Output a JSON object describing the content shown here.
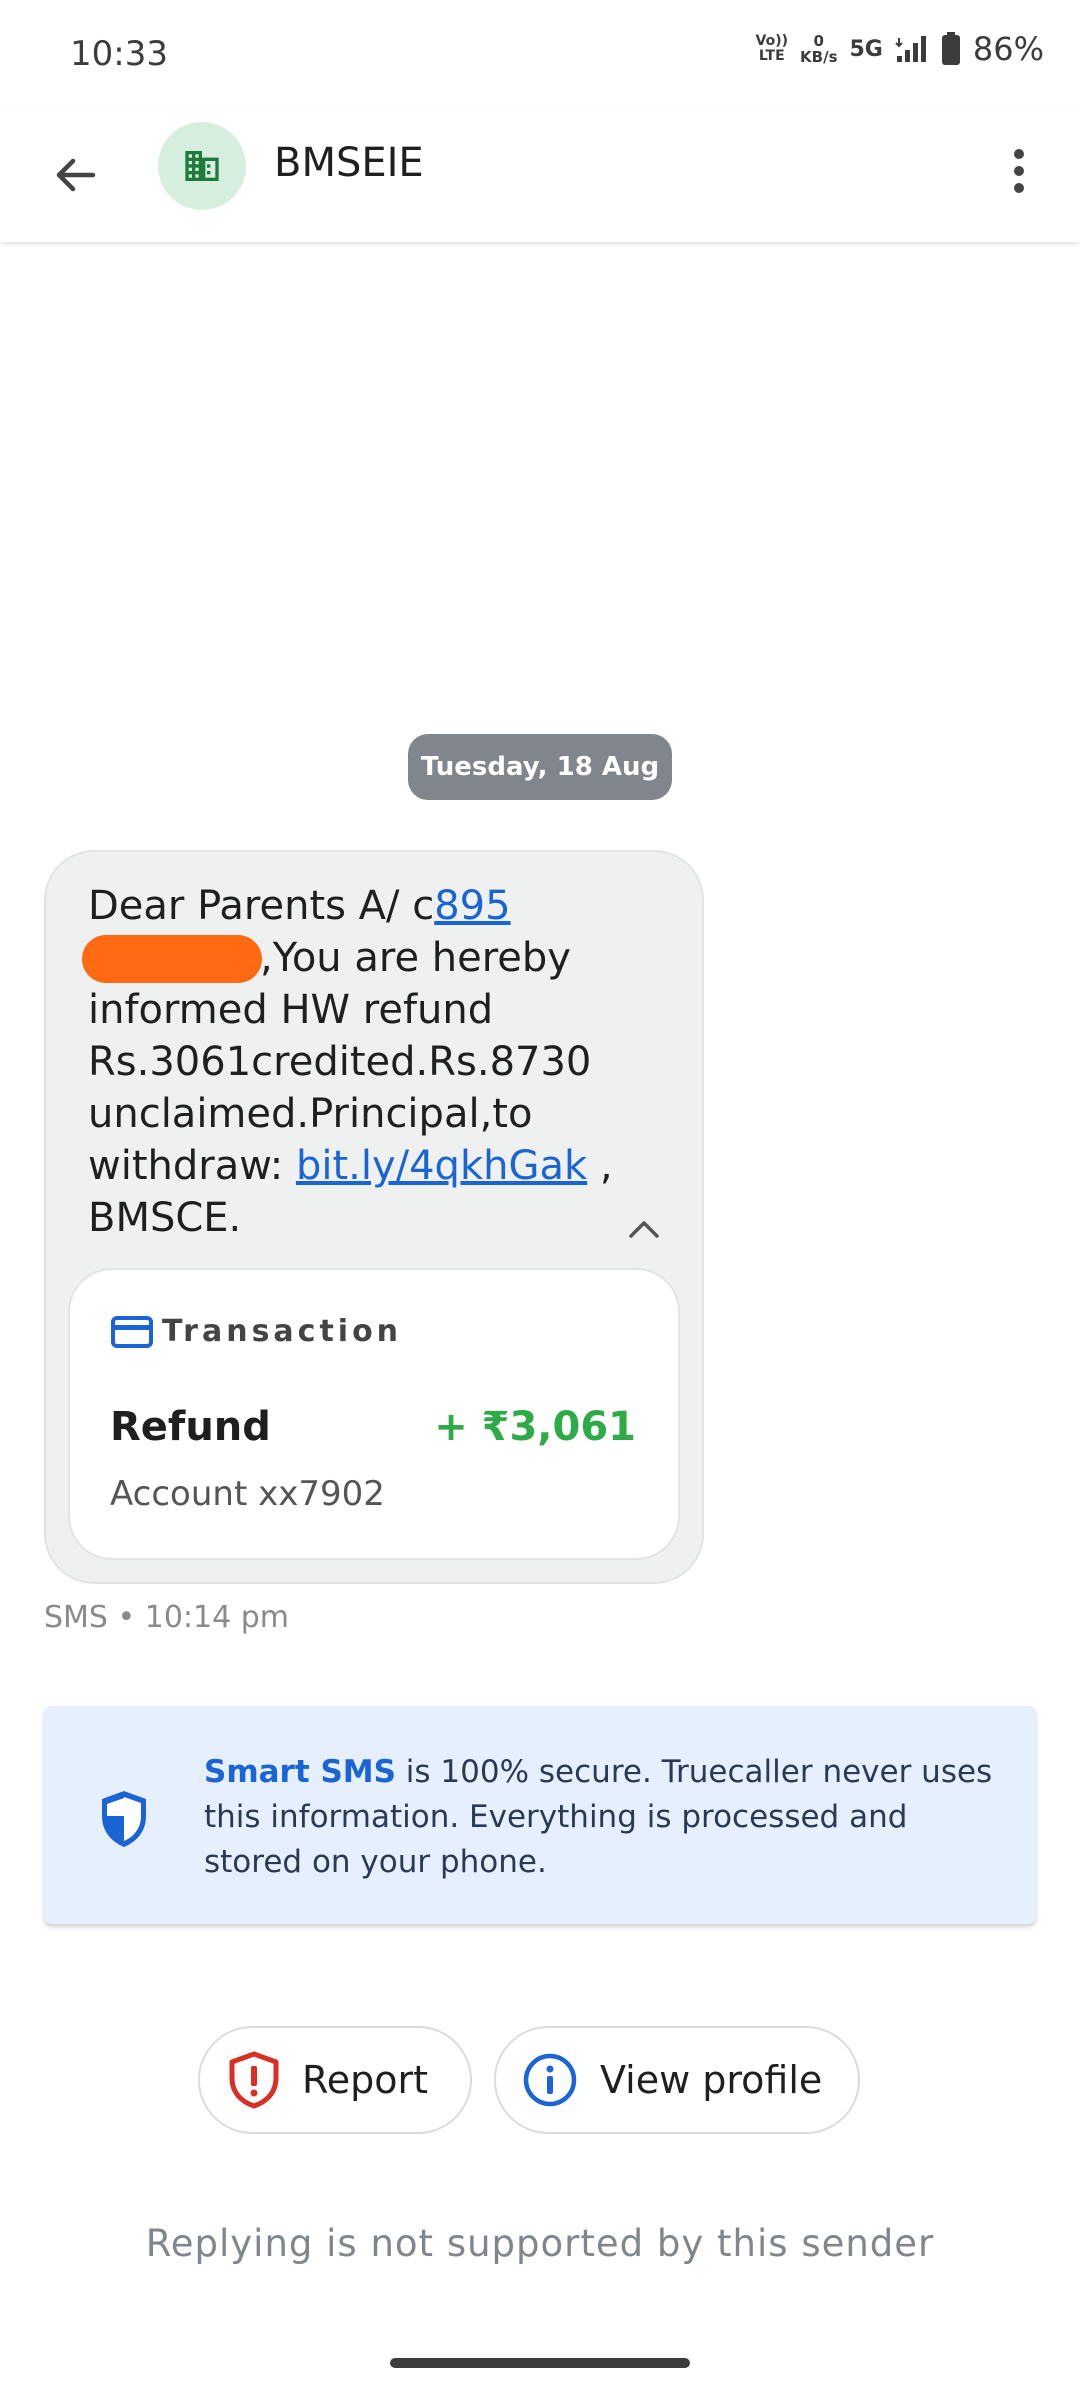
{
  "status_bar": {
    "time": "10:33",
    "volte_top": "Vo))",
    "volte_bottom": "LTE",
    "data_speed_value": "0",
    "data_speed_unit": "KB/s",
    "network": "5G",
    "battery": "86%"
  },
  "header": {
    "sender_name": "BMSEIE",
    "avatar_icon": "building-icon",
    "avatar_bg": "#d6eedd",
    "avatar_fg": "#1e7b3c"
  },
  "conversation": {
    "date_chip": "Tuesday, 18 Aug",
    "message": {
      "text_before_number": "Dear Parents A/ c",
      "account_number_visible": "895",
      "text_after_number": ",You are hereby informed HW refund Rs.3061credited.Rs.8730 unclaimed.Principal,to withdraw: ",
      "link": "bit.ly/4qkhGak",
      "text_after_link": " , BMSCE.",
      "meta": "SMS • 10:14 pm"
    },
    "transaction": {
      "label": "Transaction",
      "title": "Refund",
      "amount": "+ ₹3,061",
      "account": "Account xx7902",
      "amount_color": "#2eaa47"
    }
  },
  "secure_banner": {
    "strong": "Smart SMS",
    "text": " is 100% secure. Truecaller never uses this information. Everything is processed and stored on your phone."
  },
  "actions": {
    "report_label": "Report",
    "view_profile_label": "View profile"
  },
  "footer": {
    "reply_note": "Replying is not supported by this sender"
  },
  "colors": {
    "link": "#1a64d6",
    "report_icon": "#d93025",
    "info_icon": "#1a64d6",
    "redaction": "#ff6a13"
  }
}
